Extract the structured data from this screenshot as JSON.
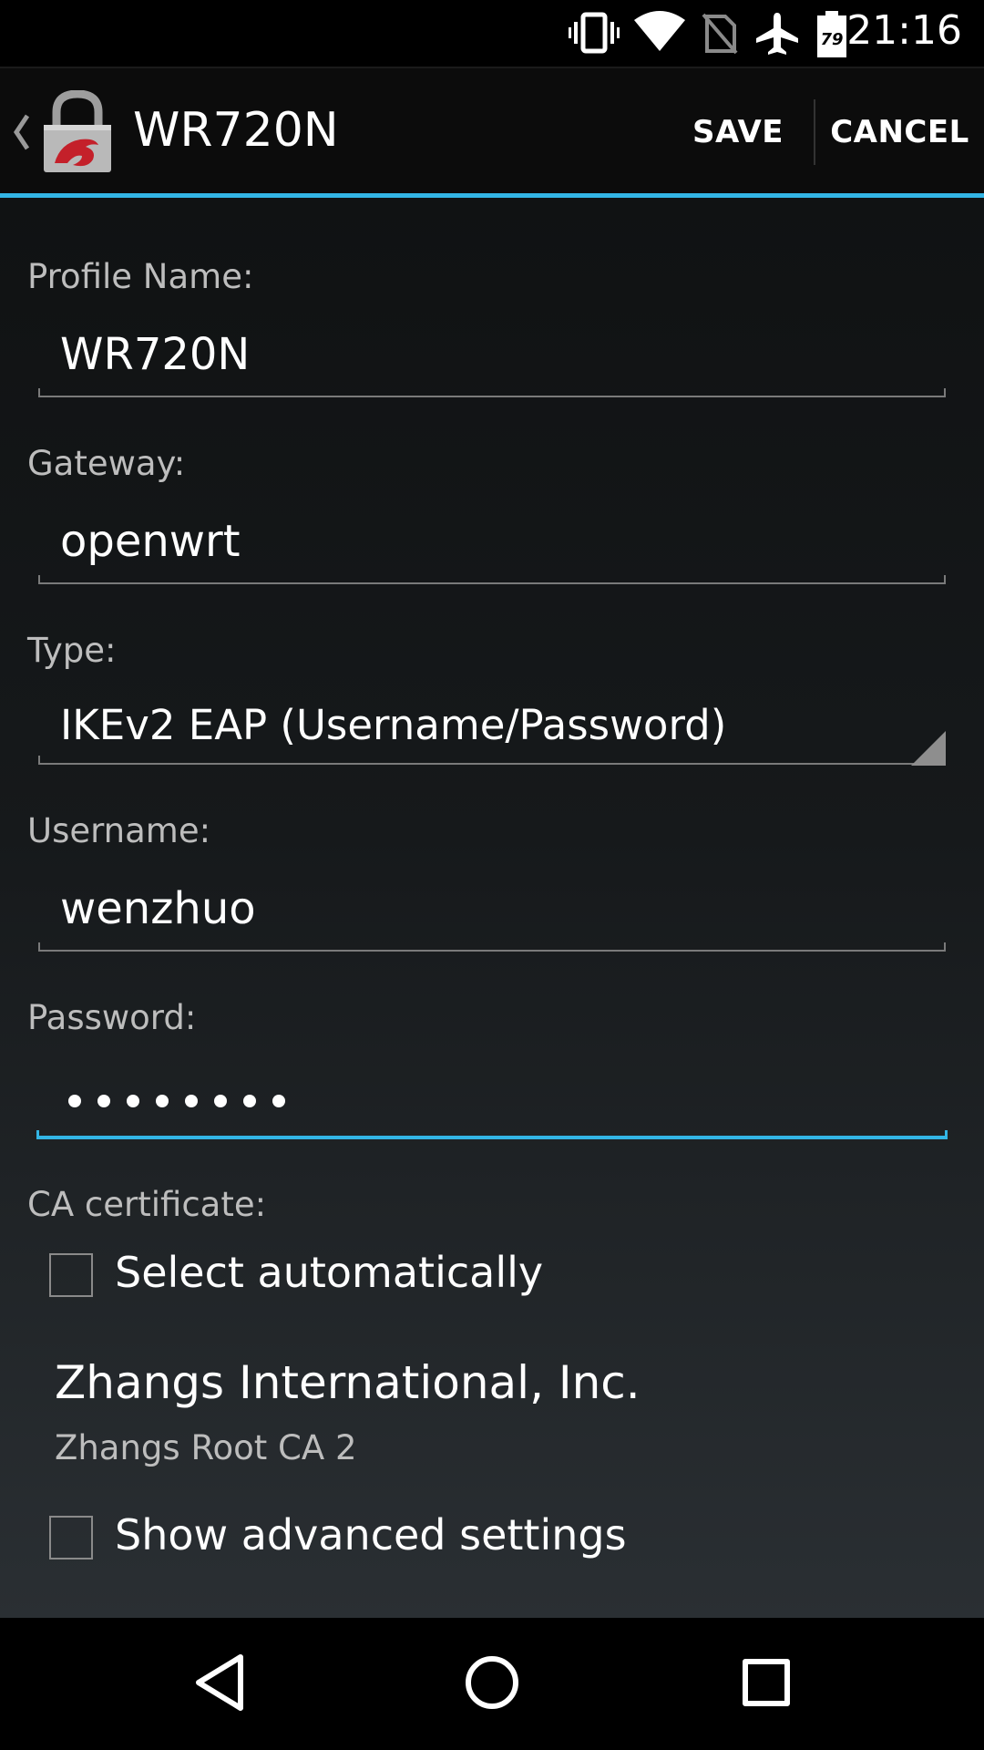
{
  "status_bar": {
    "time": "21:16",
    "battery_level": "79",
    "icons": [
      "vibrate-icon",
      "wifi-icon",
      "no-sim-icon",
      "airplane-mode-icon",
      "battery-icon"
    ]
  },
  "action_bar": {
    "title": "WR720N",
    "app_icon": "lock-app-icon",
    "save_label": "SAVE",
    "cancel_label": "CANCEL"
  },
  "form": {
    "profile_name": {
      "label": "Profile Name:",
      "value": "WR720N"
    },
    "gateway": {
      "label": "Gateway:",
      "value": "openwrt"
    },
    "type": {
      "label": "Type:",
      "value": "IKEv2 EAP (Username/Password)"
    },
    "username": {
      "label": "Username:",
      "value": "wenzhuo"
    },
    "password": {
      "label": "Password:",
      "value": "••••••••",
      "length": 8
    },
    "ca_certificate": {
      "label": "CA certificate:",
      "select_automatically": {
        "label": "Select automatically",
        "checked": false
      },
      "selected_name": "Zhangs International, Inc.",
      "selected_sub": "Zhangs Root CA 2"
    },
    "show_advanced": {
      "label": "Show advanced settings",
      "checked": false
    }
  },
  "colors": {
    "accent": "#33b5e5",
    "background": "#000000",
    "label": "#bdbdbd",
    "text": "#ffffff"
  },
  "nav_bar": {
    "icons": [
      "back-icon",
      "home-icon",
      "recents-icon"
    ]
  }
}
